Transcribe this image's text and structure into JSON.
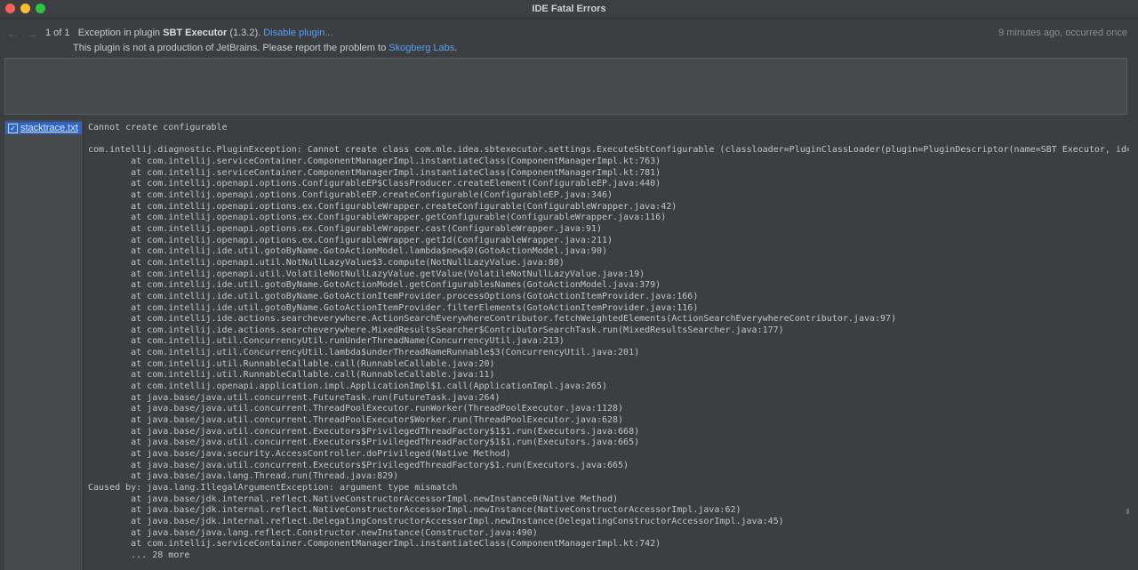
{
  "window": {
    "title": "IDE Fatal Errors"
  },
  "header": {
    "nav_back": "←",
    "nav_forward": "→",
    "counter": "1 of 1",
    "exception_prefix": "Exception in plugin",
    "plugin_name": "SBT Executor",
    "plugin_version": "(1.3.2).",
    "disable_link": "Disable plugin...",
    "notice_text": "This plugin is not a production of JetBrains. Please report the problem to",
    "vendor_link": "Skogberg Labs",
    "notice_end": ".",
    "time_ago": "9 minutes ago, occurred once"
  },
  "comment": {
    "placeholder": ""
  },
  "attachments": [
    {
      "label": "stacktrace.txt",
      "checked": true
    }
  ],
  "stacktrace": {
    "lines": [
      "Cannot create configurable",
      "",
      "com.intellij.diagnostic.PluginException: Cannot create class com.mle.idea.sbtexecutor.settings.ExecuteSbtConfigurable (classloader=PluginClassLoader(plugin=PluginDescriptor(name=SBT Executor, id=com.mle",
      "\tat com.intellij.serviceContainer.ComponentManagerImpl.instantiateClass(ComponentManagerImpl.kt:763)",
      "\tat com.intellij.serviceContainer.ComponentManagerImpl.instantiateClass(ComponentManagerImpl.kt:781)",
      "\tat com.intellij.openapi.options.ConfigurableEP$ClassProducer.createElement(ConfigurableEP.java:440)",
      "\tat com.intellij.openapi.options.ConfigurableEP.createConfigurable(ConfigurableEP.java:346)",
      "\tat com.intellij.openapi.options.ex.ConfigurableWrapper.createConfigurable(ConfigurableWrapper.java:42)",
      "\tat com.intellij.openapi.options.ex.ConfigurableWrapper.getConfigurable(ConfigurableWrapper.java:116)",
      "\tat com.intellij.openapi.options.ex.ConfigurableWrapper.cast(ConfigurableWrapper.java:91)",
      "\tat com.intellij.openapi.options.ex.ConfigurableWrapper.getId(ConfigurableWrapper.java:211)",
      "\tat com.intellij.ide.util.gotoByName.GotoActionModel.lambda$new$0(GotoActionModel.java:90)",
      "\tat com.intellij.openapi.util.NotNullLazyValue$3.compute(NotNullLazyValue.java:80)",
      "\tat com.intellij.openapi.util.VolatileNotNullLazyValue.getValue(VolatileNotNullLazyValue.java:19)",
      "\tat com.intellij.ide.util.gotoByName.GotoActionModel.getConfigurablesNames(GotoActionModel.java:379)",
      "\tat com.intellij.ide.util.gotoByName.GotoActionItemProvider.processOptions(GotoActionItemProvider.java:166)",
      "\tat com.intellij.ide.util.gotoByName.GotoActionItemProvider.filterElements(GotoActionItemProvider.java:116)",
      "\tat com.intellij.ide.actions.searcheverywhere.ActionSearchEverywhereContributor.fetchWeightedElements(ActionSearchEverywhereContributor.java:97)",
      "\tat com.intellij.ide.actions.searcheverywhere.MixedResultsSearcher$ContributorSearchTask.run(MixedResultsSearcher.java:177)",
      "\tat com.intellij.util.ConcurrencyUtil.runUnderThreadName(ConcurrencyUtil.java:213)",
      "\tat com.intellij.util.ConcurrencyUtil.lambda$underThreadNameRunnable$3(ConcurrencyUtil.java:201)",
      "\tat com.intellij.util.RunnableCallable.call(RunnableCallable.java:20)",
      "\tat com.intellij.util.RunnableCallable.call(RunnableCallable.java:11)",
      "\tat com.intellij.openapi.application.impl.ApplicationImpl$1.call(ApplicationImpl.java:265)",
      "\tat java.base/java.util.concurrent.FutureTask.run(FutureTask.java:264)",
      "\tat java.base/java.util.concurrent.ThreadPoolExecutor.runWorker(ThreadPoolExecutor.java:1128)",
      "\tat java.base/java.util.concurrent.ThreadPoolExecutor$Worker.run(ThreadPoolExecutor.java:628)",
      "\tat java.base/java.util.concurrent.Executors$PrivilegedThreadFactory$1$1.run(Executors.java:668)",
      "\tat java.base/java.util.concurrent.Executors$PrivilegedThreadFactory$1$1.run(Executors.java:665)",
      "\tat java.base/java.security.AccessController.doPrivileged(Native Method)",
      "\tat java.base/java.util.concurrent.Executors$PrivilegedThreadFactory$1.run(Executors.java:665)",
      "\tat java.base/java.lang.Thread.run(Thread.java:829)",
      "Caused by: java.lang.IllegalArgumentException: argument type mismatch",
      "\tat java.base/jdk.internal.reflect.NativeConstructorAccessorImpl.newInstance0(Native Method)",
      "\tat java.base/jdk.internal.reflect.NativeConstructorAccessorImpl.newInstance(NativeConstructorAccessorImpl.java:62)",
      "\tat java.base/jdk.internal.reflect.DelegatingConstructorAccessorImpl.newInstance(DelegatingConstructorAccessorImpl.java:45)",
      "\tat java.base/java.lang.reflect.Constructor.newInstance(Constructor.java:490)",
      "\tat com.intellij.serviceContainer.ComponentManagerImpl.instantiateClass(ComponentManagerImpl.kt:742)",
      "\t... 28 more"
    ]
  }
}
